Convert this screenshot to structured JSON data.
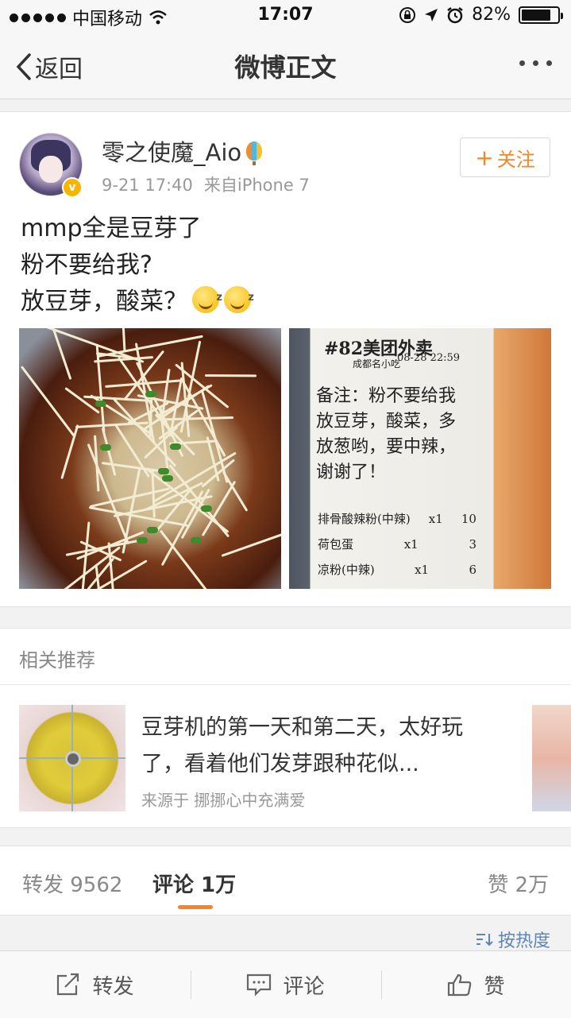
{
  "status_bar": {
    "carrier": "中国移动",
    "time": "17:07",
    "battery": "82%",
    "battery_level": 0.82
  },
  "nav": {
    "back_label": "返回",
    "title": "微博正文"
  },
  "post": {
    "username": "零之使魔_Aio",
    "date": "9-21 17:40",
    "source": "来自iPhone 7",
    "follow_label": "关注",
    "lines": [
      "mmp全是豆芽了",
      "粉不要给我?",
      "放豆芽，酸菜？"
    ],
    "receipt": {
      "order_no": "#82美团外卖",
      "shop": "成都名小吃",
      "time": "08-28 22:59",
      "note": [
        "备注：粉不要给我",
        "放豆芽，酸菜，多",
        "放葱哟，要中辣，",
        "谢谢了！"
      ],
      "items": [
        {
          "name": "排骨酸辣粉(中辣)",
          "qty": "x1",
          "price": "10"
        },
        {
          "name": "荷包蛋",
          "qty": "x1",
          "price": "3"
        },
        {
          "name": "凉粉(中辣)",
          "qty": "x1",
          "price": "6"
        }
      ]
    }
  },
  "related": {
    "header": "相关推荐",
    "title": "豆芽机的第一天和第二天，太好玩了，看着他们发芽跟种花似...",
    "source": "来源于 挪挪心中充满爱"
  },
  "tabs": {
    "repost": "转发 9562",
    "comment": "评论 1万",
    "like": "赞 2万"
  },
  "sort_label": "按热度",
  "toolbar": {
    "repost": "转发",
    "comment": "评论",
    "like": "赞"
  },
  "colors": {
    "accent": "#f68526",
    "link": "#5c85b8",
    "background": "#f2f2f2"
  }
}
